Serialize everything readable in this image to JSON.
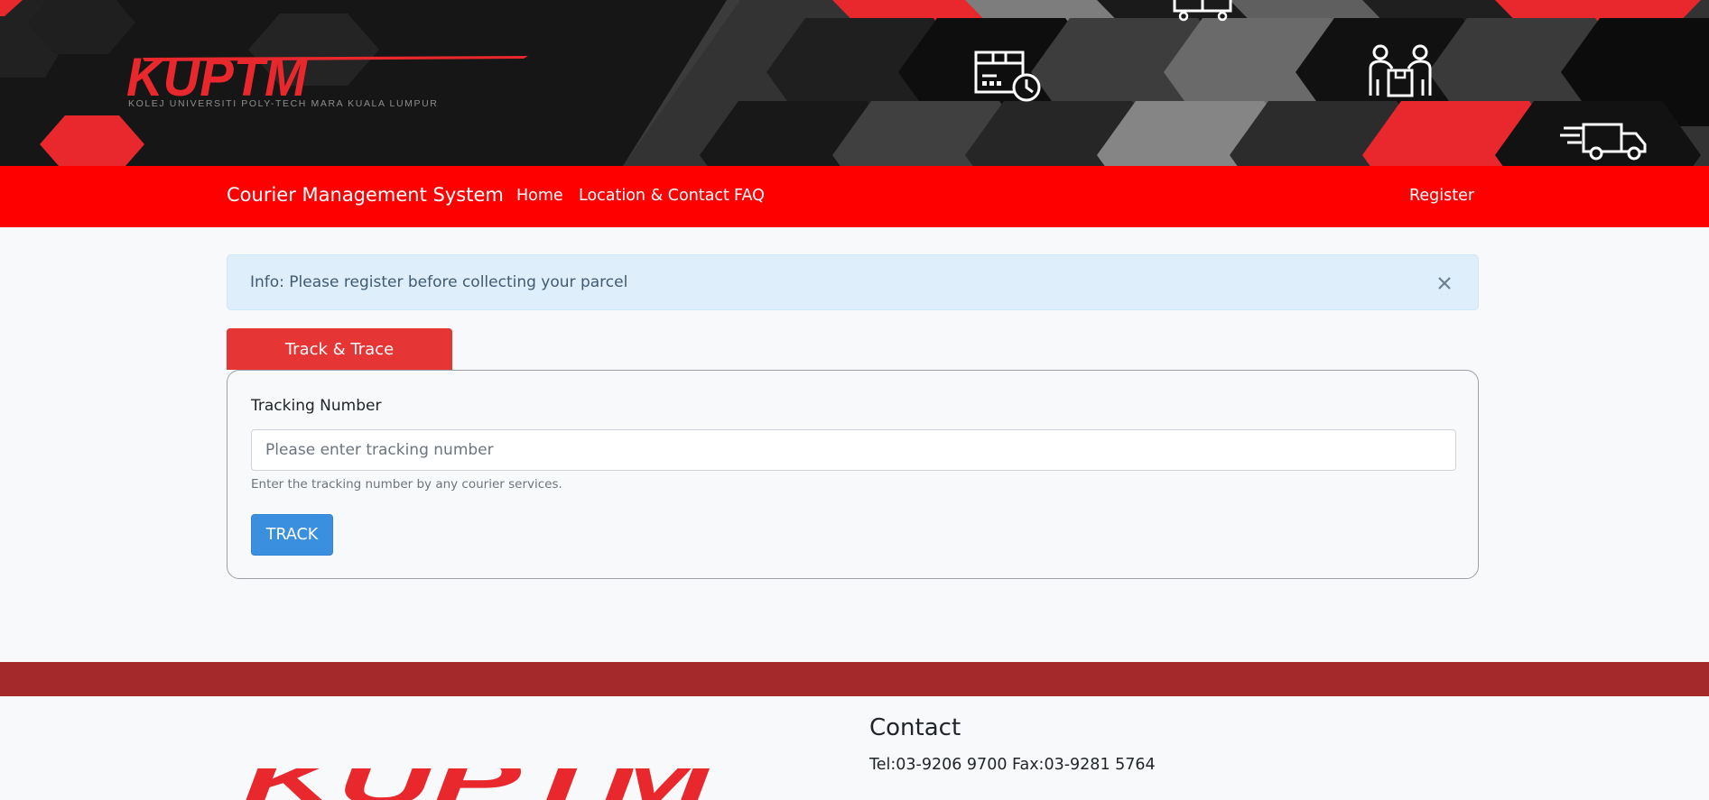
{
  "banner": {
    "logo_text": "KUPTM",
    "logo_tagline": "KOLEJ UNIVERSITI POLY-TECH MARA KUALA LUMPUR",
    "icons": [
      "parcel-clock-icon",
      "delivery-cart-icon",
      "courier-handover-icon",
      "delivery-truck-icon"
    ]
  },
  "navbar": {
    "brand": "Courier Management System",
    "links": [
      "Home",
      "Location & Contact",
      "FAQ"
    ],
    "register": "Register"
  },
  "alert": {
    "text": "Info: Please register before collecting your parcel",
    "close_icon": "close-icon"
  },
  "tracking": {
    "tab_label": "Track & Trace",
    "label": "Tracking Number",
    "placeholder": "Please enter tracking number",
    "value": "",
    "help": "Enter the tracking number by any courier services.",
    "button": "TRACK"
  },
  "footer": {
    "logo_text": "KUPTM",
    "contact_heading": "Contact",
    "contact_line": "Tel:03-9206 9700 Fax:03-9281 5764"
  },
  "colors": {
    "navbar": "#ff0000",
    "tab": "#e53535",
    "track_button": "#3a8fde",
    "footer_bar": "#a4292b",
    "alert_bg": "#deeefa",
    "hex_red": "#e8282c"
  }
}
